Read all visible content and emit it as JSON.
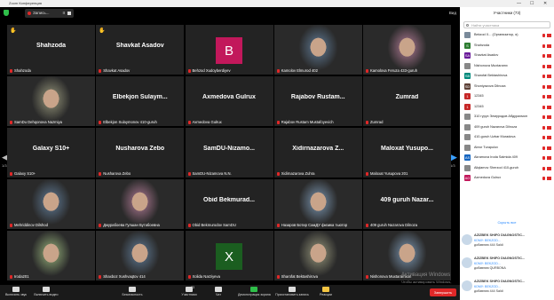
{
  "window": {
    "title": "Zoom Конференция",
    "controls": [
      "—",
      "☐",
      "✕"
    ]
  },
  "topbar": {
    "recording_label": "Запись...",
    "pause_label": "II",
    "view_label": "Вид"
  },
  "nav": {
    "page_left": "1/3",
    "page_right": "1/3"
  },
  "tiles": [
    {
      "big": "Shahzoda",
      "name": "Shahzoda",
      "hand": "✋"
    },
    {
      "big": "Shavkat Asadov",
      "name": "Shavkat Asadov",
      "hand": "✋"
    },
    {
      "avatar_letter": "B",
      "avatar_color": "#c2185b",
      "name": "Behzod Xudoyberdiyev"
    },
    {
      "video": true,
      "name": "Kamolov Elmurod 402"
    },
    {
      "video": true,
      "name": "Kamolova Feruza 433-guruh"
    },
    {
      "video": true,
      "name": "SamDu Dehqonova Nazmiya"
    },
    {
      "big": "Elbekjon Sulaym...",
      "name": "Elbekjon Sulaymonov 410-guruh"
    },
    {
      "big": "Axmedova Gulrux",
      "name": "Axmedova Gulrux"
    },
    {
      "big": "Rajabov Rustam...",
      "name": "Rajabov Rustam Mustafoyevich"
    },
    {
      "big": "Zumrad",
      "name": "Zumrad"
    },
    {
      "big": "Galaxy S10+",
      "name": "Galaxy S10+"
    },
    {
      "big": "Nusharova Zebo",
      "name": "Nusharova Zebo"
    },
    {
      "big": "SamDU-Nizamo...",
      "name": "SamDU-Nizamova N.N."
    },
    {
      "big": "Xidirnazarova Z...",
      "name": "Xidirnazarova Zuhra"
    },
    {
      "big": "Maloxat Yusupo...",
      "name": "Maloxat Yusupova 201"
    },
    {
      "video": true,
      "name": "Mehriddinov Dilshod"
    },
    {
      "video": true,
      "name": "Джурабоева Гулшан Бутабоевна"
    },
    {
      "big": "Obid Bekmurad...",
      "name": "Obid Bekmurodov SamDU"
    },
    {
      "video": true,
      "name": "Назаров Ботир СамДУ физика тьютор"
    },
    {
      "big": "409 guruh Nazar...",
      "name": "409 guruh Nazarova Dilnoza"
    },
    {
      "video": true,
      "name": "Iroda201"
    },
    {
      "video": true,
      "name": "Shaxboz Xushvaqtov 414"
    },
    {
      "avatar_letter": "X",
      "avatar_color": "#1b5e20",
      "name": "Xolida Narziyeva"
    },
    {
      "video": true,
      "name": "Sharofat Bektashirova",
      "active": true
    },
    {
      "video": true,
      "name": "Nishonova Muxtaramxon"
    }
  ],
  "toolbar": [
    {
      "label": "Включить звук"
    },
    {
      "label": "Включить видео"
    },
    {
      "label": "Безопасность"
    },
    {
      "label": "Участники",
      "badge": "73"
    },
    {
      "label": "Чат"
    },
    {
      "label": "Демонстрация экрана"
    },
    {
      "label": "Приостановить запись"
    },
    {
      "label": "Реакции"
    }
  ],
  "end_label": "Завершить",
  "watermark": {
    "line1": "Активация Windows",
    "line2": "Чтобы активировать Windows, перейдите в..."
  },
  "panel": {
    "title": "Участники (73)",
    "search_placeholder": "Найти участника",
    "participants": [
      {
        "initials": "",
        "color": "#7a8a9a",
        "name": "Bekzod X... (Организатор, я)"
      },
      {
        "initials": "S",
        "color": "#2e7d32",
        "name": "Shahzoda"
      },
      {
        "initials": "SA",
        "color": "#6a1b9a",
        "name": "Shavkat Asadov"
      },
      {
        "initials": "",
        "color": "#888",
        "name": "Nishonova Muxtaramx"
      },
      {
        "initials": "SB",
        "color": "#00897b",
        "name": "Sharofat Bektashirova"
      },
      {
        "initials": "SD",
        "color": "#5d4037",
        "name": "Shoniyazova Dilnoza"
      },
      {
        "initials": "1",
        "color": "#c62828",
        "name": "12345"
      },
      {
        "initials": "1",
        "color": "#c62828",
        "name": "12345"
      },
      {
        "initials": "",
        "color": "#888",
        "name": "310 гурух Элмуродов Абдурахмон"
      },
      {
        "initials": "",
        "color": "#888",
        "name": "409 guruh Nazarova Dilnoza"
      },
      {
        "initials": "",
        "color": "#888",
        "name": "410-guruh Uzbar Muradova"
      },
      {
        "initials": "",
        "color": "#888",
        "name": "Abror Turapulov"
      },
      {
        "initials": "AS",
        "color": "#1565c0",
        "name": "Akramova Iroda Salmida 409"
      },
      {
        "initials": "",
        "color": "#888",
        "name": "Aliqlamov Sherzod 410-guruh"
      },
      {
        "initials": "AG",
        "color": "#c2185b",
        "name": "Axmedova Gulrux"
      }
    ],
    "collapse_label": "Скрыть все",
    "chat": [
      {
        "from": "AZIZBEK SHIFO DIAGNOSTIC...",
        "to": "КОМУ: BEKZOD...",
        "text": "добавляю 444 Saldi"
      },
      {
        "from": "AZIZBEK SHIFO DIAGNOSTIC...",
        "to": "КОМУ: BEKZOD...",
        "text": "добавляю QURBONA"
      },
      {
        "from": "AZIZBEK SHIFO DIAGNOSTIC...",
        "to": "КОМУ: BEKZOD...",
        "text": "добавляю 444 Saldi"
      }
    ]
  },
  "colors": {
    "accent": "#2d8cff",
    "active_speaker": "#f5e64a",
    "muted": "#e02828",
    "end": "#e02828"
  }
}
